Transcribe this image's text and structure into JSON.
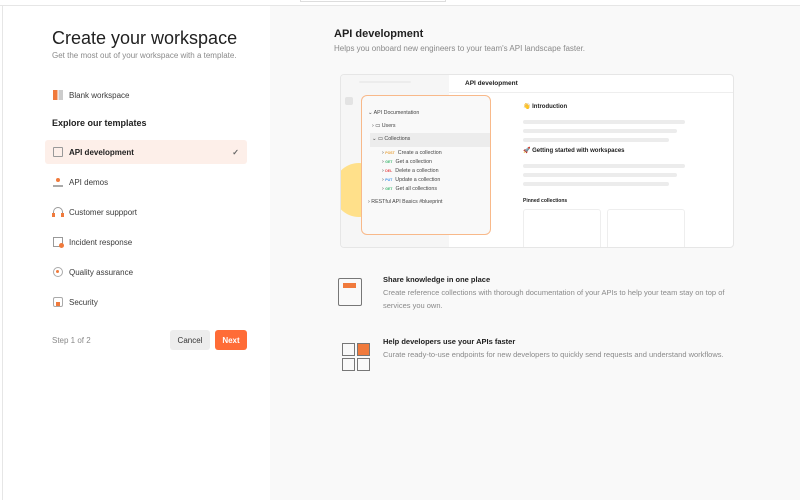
{
  "left": {
    "title": "Create your workspace",
    "subtitle": "Get the most out of your workspace with a template.",
    "blank": "Blank workspace",
    "templates_heading": "Explore our templates",
    "templates": [
      {
        "label": "API development",
        "selected": true
      },
      {
        "label": "API demos"
      },
      {
        "label": "Customer suppport"
      },
      {
        "label": "Incident response"
      },
      {
        "label": "Quality assurance"
      },
      {
        "label": "Security"
      }
    ],
    "step": "Step 1 of 2",
    "cancel": "Cancel",
    "next": "Next"
  },
  "right": {
    "title": "API development",
    "subtitle": "Helps you onboard new engineers to your team's API landscape faster.",
    "preview": {
      "workspace": "API development",
      "root": "API Documentation",
      "folders": [
        "Users",
        "Collections"
      ],
      "requests": [
        {
          "method": "POST",
          "label": "Create a collection",
          "color": "#e8a33d"
        },
        {
          "method": "GET",
          "label": "Get a collection",
          "color": "#39b66c"
        },
        {
          "method": "DEL",
          "label": "Delete a collection",
          "color": "#e5484d"
        },
        {
          "method": "PUT",
          "label": "Update a collection",
          "color": "#3a8ee6"
        },
        {
          "method": "GET",
          "label": "Get all collections",
          "color": "#39b66c"
        }
      ],
      "other": "RESTful API Basics #blueprint",
      "intro": "👋 Introduction",
      "getting_started": "🚀 Getting started with workspaces",
      "pinned": "Pinned collections"
    },
    "features": [
      {
        "title": "Share knowledge in one place",
        "desc": "Create reference collections with thorough documentation of your APIs to help your team stay on top of services you own."
      },
      {
        "title": "Help developers use your APIs faster",
        "desc": "Curate ready-to-use endpoints for new developers to quickly send requests and understand workflows."
      }
    ]
  },
  "colors": {
    "accent": "#ff6c37"
  }
}
